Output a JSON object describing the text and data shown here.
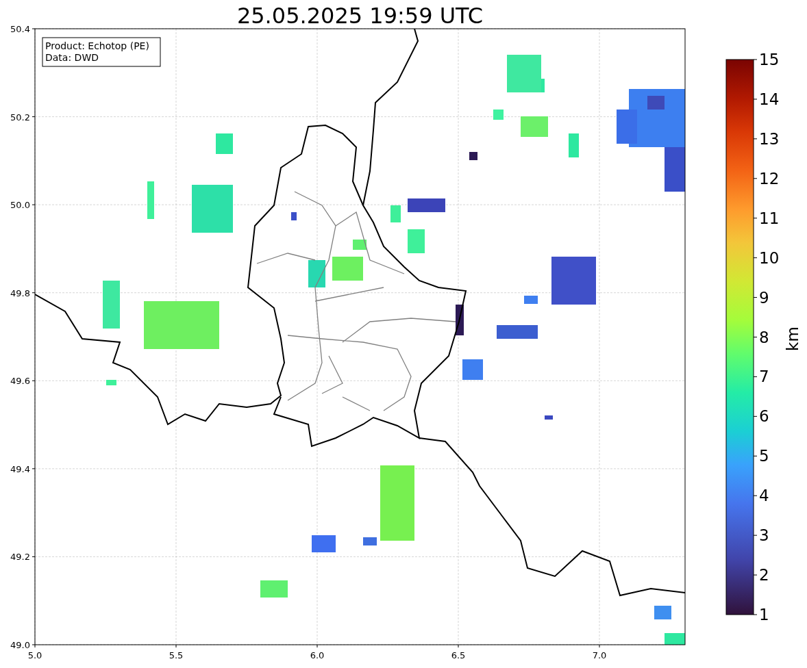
{
  "title": "25.05.2025 19:59 UTC",
  "info_box": [
    "Product: Echotop (PE)",
    "Data: DWD"
  ],
  "x_ticks": [
    "5.0",
    "5.5",
    "6.0",
    "6.5",
    "7.0"
  ],
  "y_ticks": [
    "50.4",
    "50.2",
    "50.0",
    "49.8",
    "49.6",
    "49.4",
    "49.2",
    "49.0"
  ],
  "colorbar": {
    "label": "km",
    "ticks": [
      "15",
      "14",
      "13",
      "12",
      "11",
      "10",
      "9",
      "8",
      "7",
      "6",
      "5",
      "4",
      "3",
      "2",
      "1"
    ]
  }
}
